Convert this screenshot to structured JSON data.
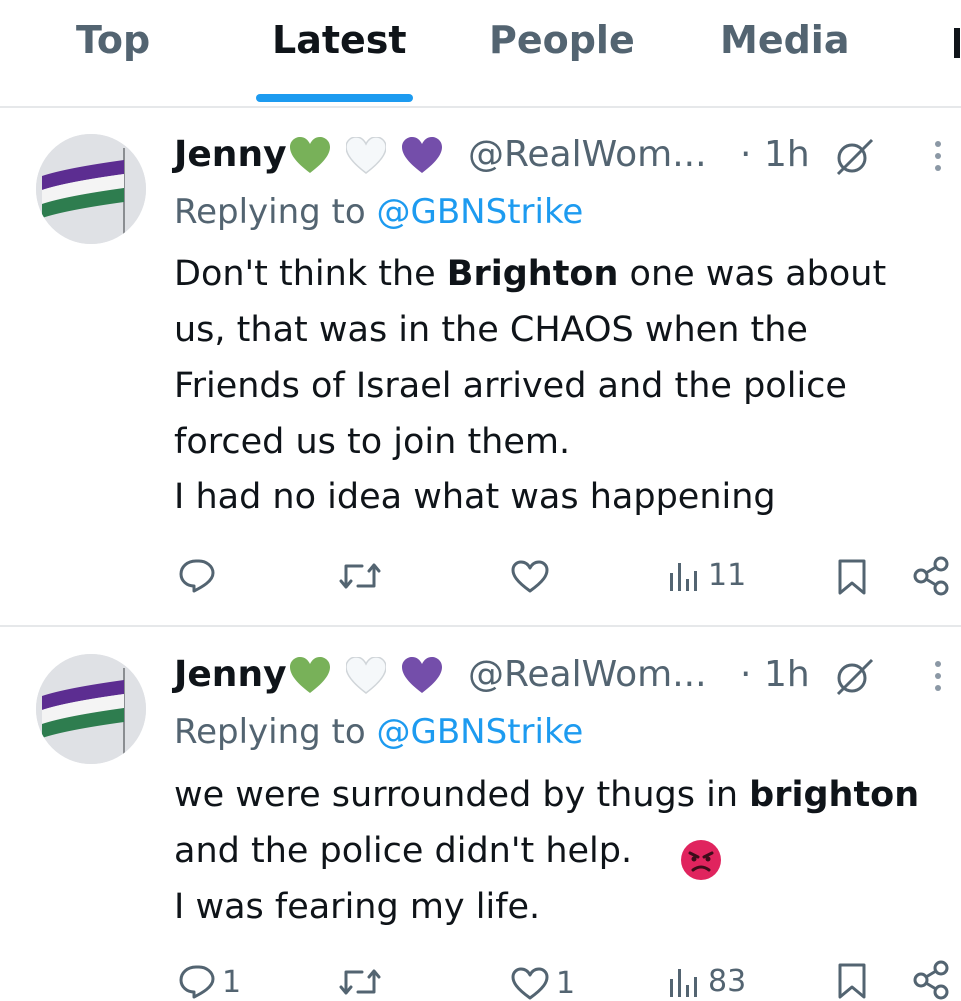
{
  "tabs": [
    {
      "label": "Top"
    },
    {
      "label": "Latest",
      "active": true
    },
    {
      "label": "People"
    },
    {
      "label": "Media"
    }
  ],
  "tweets": [
    {
      "name": "Jenny",
      "handle": "@RealWom...",
      "dot": "·",
      "time": "1h",
      "replying_prefix": "Replying to ",
      "replying_to": "@GBNStrike",
      "lines": [
        {
          "before": "Don't think the ",
          "bold": "Brighton",
          "after": " one was about"
        },
        {
          "before": "us, that was in the CHAOS when the"
        },
        {
          "before": "Friends of Israel arrived and the police"
        },
        {
          "before": "forced us to join them."
        },
        {
          "before": "I had no idea what was happening"
        }
      ],
      "stats": {
        "replies": "",
        "retweets": "",
        "likes": "",
        "views": "11"
      }
    },
    {
      "name": "Jenny",
      "handle": "@RealWom...",
      "dot": "·",
      "time": "1h",
      "replying_prefix": "Replying to ",
      "replying_to": "@GBNStrike",
      "lines": [
        {
          "before": "we were surrounded by thugs in ",
          "bold": "brighton"
        },
        {
          "before": "and the police didn't help."
        },
        {
          "before": "I was fearing my life."
        }
      ],
      "stats": {
        "replies": "1",
        "retweets": "",
        "likes": "1",
        "views": "83"
      }
    }
  ],
  "icons": {
    "hearts": [
      "green-heart-icon",
      "white-heart-icon",
      "purple-heart-icon"
    ],
    "emoji": "angry-face-icon"
  },
  "colors": {
    "accent": "#1d9bf0",
    "secondary_text": "#536471",
    "primary_text": "#0f1419",
    "heart_green": "#78b159",
    "heart_purple": "#744eaa",
    "flag_purple": "#5c2d91",
    "flag_green": "#2e7d4f"
  }
}
